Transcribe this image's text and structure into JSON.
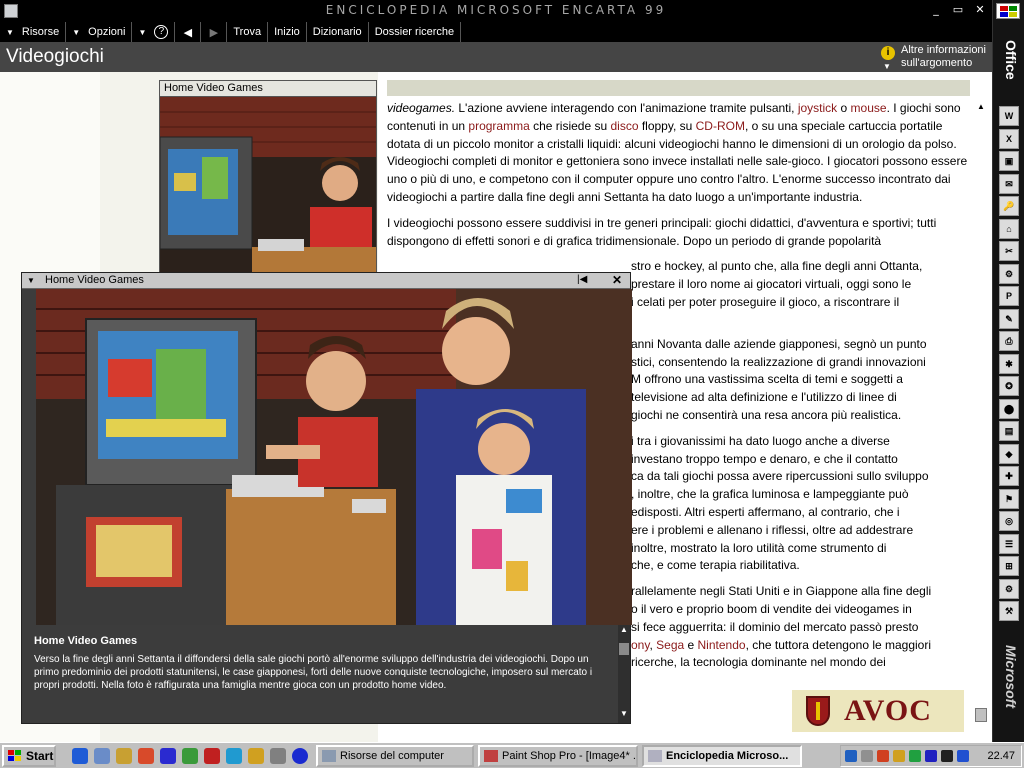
{
  "window": {
    "title": "ENCICLOPEDIA MICROSOFT ENCARTA 99",
    "controls": [
      "_",
      "▭",
      "✕"
    ]
  },
  "menu": [
    {
      "label": "Risorse",
      "dropdown": true
    },
    {
      "label": "Opzioni",
      "dropdown": true
    },
    {
      "label": "?"
    },
    {
      "label": "Trova"
    },
    {
      "label": "Inizio"
    },
    {
      "label": "Dizionario"
    },
    {
      "label": "Dossier ricerche"
    }
  ],
  "header": {
    "title": "Videogiochi",
    "more_info_line1": "Altre informazioni",
    "more_info_line2": "sull'argomento"
  },
  "thumbnail": {
    "caption": "Home Video Games"
  },
  "article": {
    "p1": [
      {
        "t": "videogames.",
        "style": "italic"
      },
      {
        "t": " L'azione avviene interagendo con l'animazione tramite pulsanti, "
      },
      {
        "t": "joystick",
        "style": "link"
      },
      {
        "t": " o "
      },
      {
        "t": "mouse",
        "style": "link"
      },
      {
        "t": ". I giochi sono contenuti in un "
      },
      {
        "t": "programma",
        "style": "link"
      },
      {
        "t": " che risiede su "
      },
      {
        "t": "disco",
        "style": "link"
      },
      {
        "t": " floppy, su "
      },
      {
        "t": "CD-ROM",
        "style": "link"
      },
      {
        "t": ", o su una speciale cartuccia portatile dotata di un piccolo monitor a cristalli liquidi: alcuni videogiochi hanno le dimensioni di un orologio da polso. Videogiochi completi di monitor e gettoniera sono invece installati nelle sale-gioco. I giocatori possono essere uno o più di uno, e competono con il computer oppure uno contro l'altro. L'enorme successo incontrato dai videogiochi a partire dalla fine degli anni Settanta ha dato luogo a un'importante industria."
      }
    ],
    "p2": [
      {
        "t": " I videogiochi possono essere suddivisi in tre generi principali: giochi didattici, d'avventura e sportivi; tutti dispongono di effetti sonori e di grafica tridimensionale. Dopo un periodo di grande popolarità"
      }
    ],
    "p2_visible_right": [
      {
        "t": "stro e hockey, al punto che, alla fine degli anni Ottanta,"
      },
      {
        "t": "prestare il loro nome ai giocatori virtuali, oggi sono le"
      },
      {
        "t": "i celati per poter proseguire il gioco, a riscontrare il"
      }
    ],
    "p3_visible_right": [
      {
        "t": " anni Novanta dalle aziende giapponesi, segnò un punto"
      },
      {
        "t": "stici, consentendo la realizzazione di grandi innovazioni"
      },
      {
        "t": "M offrono una vastissima scelta di temi e soggetti a"
      },
      {
        "t": "televisione ad alta definizione e l'utilizzo di linee di"
      },
      {
        "t": " giochi ne consentirà una resa ancora più realistica."
      }
    ],
    "p4_visible_right": [
      {
        "t": "i tra i giovanissimi ha dato luogo anche a diverse"
      },
      {
        "t": " investano troppo tempo e denaro, e che il contatto"
      },
      {
        "t": "ca da tali giochi possa avere ripercussioni sullo sviluppo"
      },
      {
        "t": ", inoltre, che la grafica luminosa e lampeggiante può"
      },
      {
        "t": "edisposti. Altri esperti affermano, al contrario, che i"
      },
      {
        "t": "ere i problemi e allenano i riflessi, oltre ad addestrare"
      },
      {
        "t": " inoltre, mostrato la loro utilità come strumento di"
      },
      {
        "t": "che, e come terapia riabilitativa."
      }
    ],
    "p5_visible_right": [
      {
        "t": "rallelamente negli Stati Uniti e in Giappone alla fine degli"
      },
      {
        "t": "o il vero e proprio boom di vendite dei videogames in"
      },
      {
        "t": "si fece agguerrita: il dominio del mercato passò presto"
      }
    ],
    "p5_line4": [
      {
        "t": "ony",
        "style": "link"
      },
      {
        "t": ", "
      },
      {
        "t": "Sega",
        "style": "link"
      },
      {
        "t": " e "
      },
      {
        "t": "Nintendo",
        "style": "link"
      },
      {
        "t": ", che tuttora detengono le maggiori"
      }
    ],
    "p5_line5": [
      {
        "t": " ricerche, la tecnologia dominante nel mondo dei"
      }
    ]
  },
  "popup": {
    "title": "Home Video Games",
    "caption_title": "Home Video Games",
    "caption_text": "Verso la fine degli anni Settanta il diffondersi della sale giochi portò all'enorme sviluppo dell'industria dei videogiochi. Dopo un primo predominio dei prodotti statunitensi, le case giapponesi, forti delle nuove conquiste tecnologiche, imposero sul mercato i propri prodotti. Nella foto è raffigurata una famiglia mentre gioca con un prodotto home video."
  },
  "office_bar": {
    "label": "Office",
    "vendor": "Microsoft",
    "buttons": [
      "W",
      "X",
      "▣",
      "✉",
      "🔑",
      "⌂",
      "✂",
      "⚙",
      "P",
      "✎",
      "⎙",
      "✱",
      "✪",
      "⬤",
      "▤",
      "◆",
      "✚",
      "⚑",
      "◎",
      "☰",
      "⊞",
      "⚙",
      "⚒"
    ]
  },
  "logo": {
    "text": "AVOC"
  },
  "taskbar": {
    "start": "Start",
    "tasks": [
      {
        "label": "Risorse del computer",
        "active": false
      },
      {
        "label": "Paint Shop Pro - [Image4* ...",
        "active": false
      },
      {
        "label": "Enciclopedia Microso...",
        "active": true
      }
    ],
    "clock": "22.47"
  }
}
